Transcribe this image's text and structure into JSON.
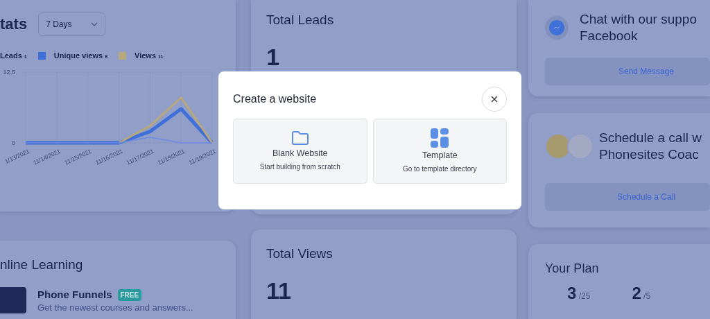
{
  "stats_card": {
    "title": "tats",
    "range_select": {
      "value": "7 Days"
    },
    "legend": [
      {
        "count": "1",
        "swatch": false
      },
      {
        "count": "8",
        "swatch": true
      },
      {
        "count": "11",
        "swatch": true
      }
    ],
    "chart_data": {
      "type": "line",
      "categories": [
        "1/13/2021",
        "11/14/2021",
        "11/15/2021",
        "11/16/2021",
        "11/17/2021",
        "11/18/2021",
        "11/19/2021"
      ],
      "yticks": [
        0,
        12.5
      ],
      "ylim": [
        0,
        12.5
      ],
      "series": [
        {
          "name": "Leads",
          "color": "#6d8be0",
          "values": [
            0,
            0,
            0,
            0,
            1,
            0,
            0
          ]
        },
        {
          "name": "Unique views",
          "color": "#3f6fd8",
          "values": [
            0,
            0,
            0,
            0,
            2,
            6,
            0
          ]
        },
        {
          "name": "Views",
          "color": "#b8a77a",
          "values": [
            null,
            null,
            null,
            0,
            3,
            8,
            0
          ]
        }
      ]
    }
  },
  "online_learning": {
    "title": "nline Learning",
    "courses": [
      {
        "title": "Phone Funnels",
        "badge": "FREE",
        "description": "Get the newest courses and answers..."
      }
    ]
  },
  "total_leads": {
    "title": "Total Leads",
    "value": "1"
  },
  "total_views": {
    "title": "Total Views",
    "value": "11"
  },
  "chat_card": {
    "title_lines": [
      "Chat with our suppo",
      "Facebook"
    ],
    "button": "Send Message"
  },
  "schedule_card": {
    "title_lines": [
      "Schedule a call w",
      "Phonesites Coac"
    ],
    "button": "Schedule a Call"
  },
  "plan_card": {
    "title": "Your Plan",
    "stats": [
      {
        "value": "3",
        "limit": "/25"
      },
      {
        "value": "2",
        "limit": "/5"
      }
    ]
  },
  "modal": {
    "title": "Create a website",
    "options": [
      {
        "kind": "blank",
        "title": "Blank Website",
        "subtitle": "Start building from scratch"
      },
      {
        "kind": "template",
        "title": "Template",
        "subtitle": "Go to template directory"
      }
    ]
  }
}
